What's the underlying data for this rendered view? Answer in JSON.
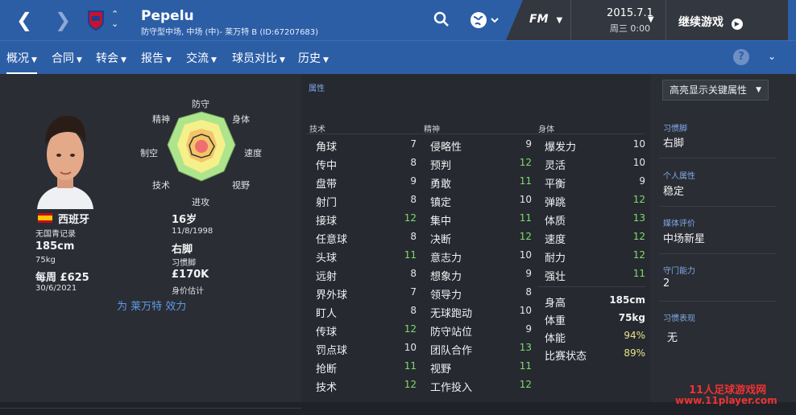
{
  "header": {
    "player_name": "Pepelu",
    "subtitle": "防守型中场, 中场 (中)- 莱万特 B (ID:67207683)",
    "date": "2015.7.1",
    "time": "周三 0:00",
    "continue": "继续游戏",
    "fm": "FM"
  },
  "tabs": [
    {
      "label": "概况"
    },
    {
      "label": "合同"
    },
    {
      "label": "转会"
    },
    {
      "label": "报告"
    },
    {
      "label": "交流"
    },
    {
      "label": "球员对比"
    },
    {
      "label": "历史"
    }
  ],
  "radar": {
    "top": "防守",
    "top_right": "身体",
    "right": "速度",
    "bottom_right": "视野",
    "bottom": "进攻",
    "bottom_left": "技术",
    "left": "制空",
    "top_left": "精神"
  },
  "bio": {
    "nationality": "西班牙",
    "youth": "无国青记录",
    "height": "185cm",
    "weight": "75kg",
    "wage": "每周 £625",
    "contract_end": "30/6/2021",
    "age": "16岁",
    "dob": "11/8/1998",
    "foot": "右脚",
    "foot_label": "习惯脚",
    "value": "£170K",
    "value_label": "身价估计",
    "plays_for": "为 莱万特 效力"
  },
  "attributes_title": "属性",
  "technical": {
    "title": "技术",
    "items": [
      {
        "n": "角球",
        "v": "7"
      },
      {
        "n": "传中",
        "v": "8"
      },
      {
        "n": "盘带",
        "v": "9"
      },
      {
        "n": "射门",
        "v": "8"
      },
      {
        "n": "接球",
        "v": "12"
      },
      {
        "n": "任意球",
        "v": "8"
      },
      {
        "n": "头球",
        "v": "11"
      },
      {
        "n": "远射",
        "v": "8"
      },
      {
        "n": "界外球",
        "v": "7"
      },
      {
        "n": "盯人",
        "v": "8"
      },
      {
        "n": "传球",
        "v": "12"
      },
      {
        "n": "罚点球",
        "v": "10"
      },
      {
        "n": "抢断",
        "v": "11"
      },
      {
        "n": "技术",
        "v": "12"
      }
    ]
  },
  "mental": {
    "title": "精神",
    "items": [
      {
        "n": "侵略性",
        "v": "9"
      },
      {
        "n": "预判",
        "v": "12"
      },
      {
        "n": "勇敢",
        "v": "11"
      },
      {
        "n": "镇定",
        "v": "10"
      },
      {
        "n": "集中",
        "v": "11"
      },
      {
        "n": "决断",
        "v": "12"
      },
      {
        "n": "意志力",
        "v": "10"
      },
      {
        "n": "想象力",
        "v": "9"
      },
      {
        "n": "领导力",
        "v": "8"
      },
      {
        "n": "无球跑动",
        "v": "10"
      },
      {
        "n": "防守站位",
        "v": "9"
      },
      {
        "n": "团队合作",
        "v": "13"
      },
      {
        "n": "视野",
        "v": "11"
      },
      {
        "n": "工作投入",
        "v": "12"
      }
    ]
  },
  "physical": {
    "title": "身体",
    "items": [
      {
        "n": "爆发力",
        "v": "10"
      },
      {
        "n": "灵活",
        "v": "10"
      },
      {
        "n": "平衡",
        "v": "9"
      },
      {
        "n": "弹跳",
        "v": "12"
      },
      {
        "n": "体质",
        "v": "13"
      },
      {
        "n": "速度",
        "v": "12"
      },
      {
        "n": "耐力",
        "v": "12"
      },
      {
        "n": "强壮",
        "v": "11"
      }
    ]
  },
  "physical_stats": [
    {
      "n": "身高",
      "v": "185cm"
    },
    {
      "n": "体重",
      "v": "75kg"
    },
    {
      "n": "体能",
      "v": "94%"
    },
    {
      "n": "比赛状态",
      "v": "89%"
    }
  ],
  "highlight_btn": "高亮显示关键属性",
  "right": {
    "foot_t": "习惯脚",
    "foot_v": "右脚",
    "pers_t": "个人属性",
    "pers_v": "稳定",
    "media_t": "媒体评价",
    "media_v": "中场新星",
    "def_t": "守门能力",
    "def_v": "2",
    "form_t": "习惯表现",
    "form_v": "无"
  },
  "watermark": {
    "line1": "11人足球游戏网",
    "line2": "www.11player.com"
  }
}
